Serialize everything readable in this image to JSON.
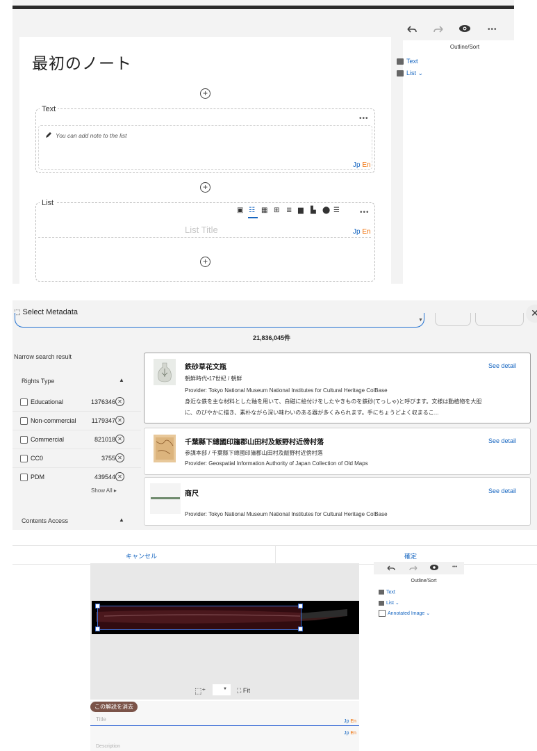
{
  "panel1": {
    "note_title": "最初のノート",
    "toolbar": {
      "undo_icon": "undo-icon",
      "redo_icon": "redo-icon",
      "preview_icon": "eye-icon",
      "more": "•••"
    },
    "text_section": {
      "label": "Text",
      "more": "•••",
      "placeholder": "You can add note to the list",
      "lang_jp": "Jp",
      "lang_en": "En"
    },
    "list_section": {
      "label": "List",
      "list_title_placeholder": "List Title",
      "more": "•••",
      "lang_jp": "Jp",
      "lang_en": "En"
    },
    "outline": {
      "header": "Outline/Sort",
      "items": [
        "Text",
        "List"
      ]
    }
  },
  "panel2": {
    "dialog_title": "Select Metadata",
    "result_count": "21,836,045件",
    "narrow_label": "Narrow search result",
    "rights_type_label": "Rights Type",
    "facets": [
      {
        "label": "Educational",
        "count": "1376346"
      },
      {
        "label": "Non-commercial",
        "count": "1179347"
      },
      {
        "label": "Commercial",
        "count": "821018"
      },
      {
        "label": "CC0",
        "count": "3755"
      },
      {
        "label": "PDM",
        "count": "439544"
      }
    ],
    "show_all": "Show All",
    "contents_access_label": "Contents Access",
    "results": [
      {
        "title": "鉄砂草花文瓶",
        "meta": "朝鮮時代•17世紀 / 朝鮮",
        "provider": "Provider: Tokyo National Museum  National Institutes for Cultural Heritage  ColBase",
        "desc1": "身近な鉄を主な材料とした釉を用いて、白磁に絵付けをしたやきものを鉄砂(てっしゃ)と呼びます。文様は動植物を大胆",
        "desc2": "に、のびやかに描き、素朴ながら深い味わいのある器が多くみられます。手にちょうどよく収まるこ...",
        "detail": "See detail"
      },
      {
        "title": "千葉縣下總國印旛郡山田村及飯野村近傍村落",
        "meta": "参謀本部 / 千葉縣下總國印旛郡山田村及飯野村近傍村落",
        "provider": "Provider: Geospatial Information Authority of Japan  Collection of Old Maps",
        "detail": "See detail"
      },
      {
        "title": "商尺",
        "provider": "Provider: Tokyo National Museum  National Institutes for Cultural Heritage  ColBase",
        "detail": "See detail"
      }
    ]
  },
  "panel3": {
    "cancel": "キャンセル",
    "confirm": "確定",
    "fit": "Fit",
    "clear_caption": "この解説を消去",
    "title_placeholder": "Title",
    "description_placeholder": "Description",
    "lang_jp": "Jp",
    "lang_en": "En",
    "outline": {
      "header": "Outline/Sort",
      "items": [
        "Text",
        "List",
        "Annotated Image"
      ]
    }
  }
}
